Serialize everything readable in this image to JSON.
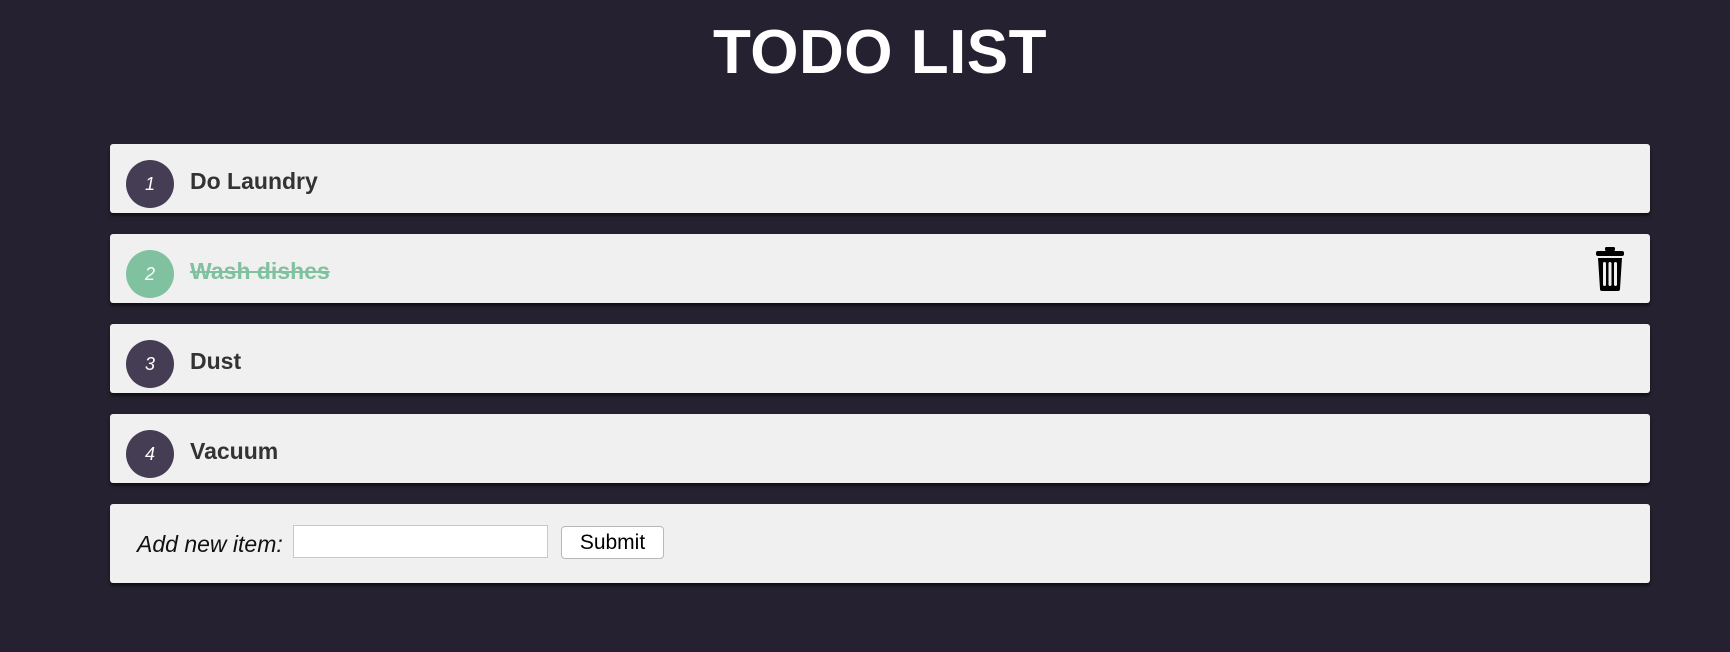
{
  "header": {
    "title": "TODO LIST"
  },
  "todos": [
    {
      "number": "1",
      "label": "Do Laundry",
      "completed": false
    },
    {
      "number": "2",
      "label": "Wash dishes",
      "completed": true
    },
    {
      "number": "3",
      "label": "Dust",
      "completed": false
    },
    {
      "number": "4",
      "label": "Vacuum",
      "completed": false
    }
  ],
  "add_form": {
    "label": "Add new item:",
    "input_value": "",
    "input_placeholder": "",
    "submit_label": "Submit"
  },
  "icons": {
    "delete": "trash-icon"
  },
  "colors": {
    "background": "#262130",
    "item_background": "#f0f0f0",
    "badge": "#443d54",
    "completed": "#80c1a0",
    "text": "#333333",
    "title": "#ffffff"
  }
}
